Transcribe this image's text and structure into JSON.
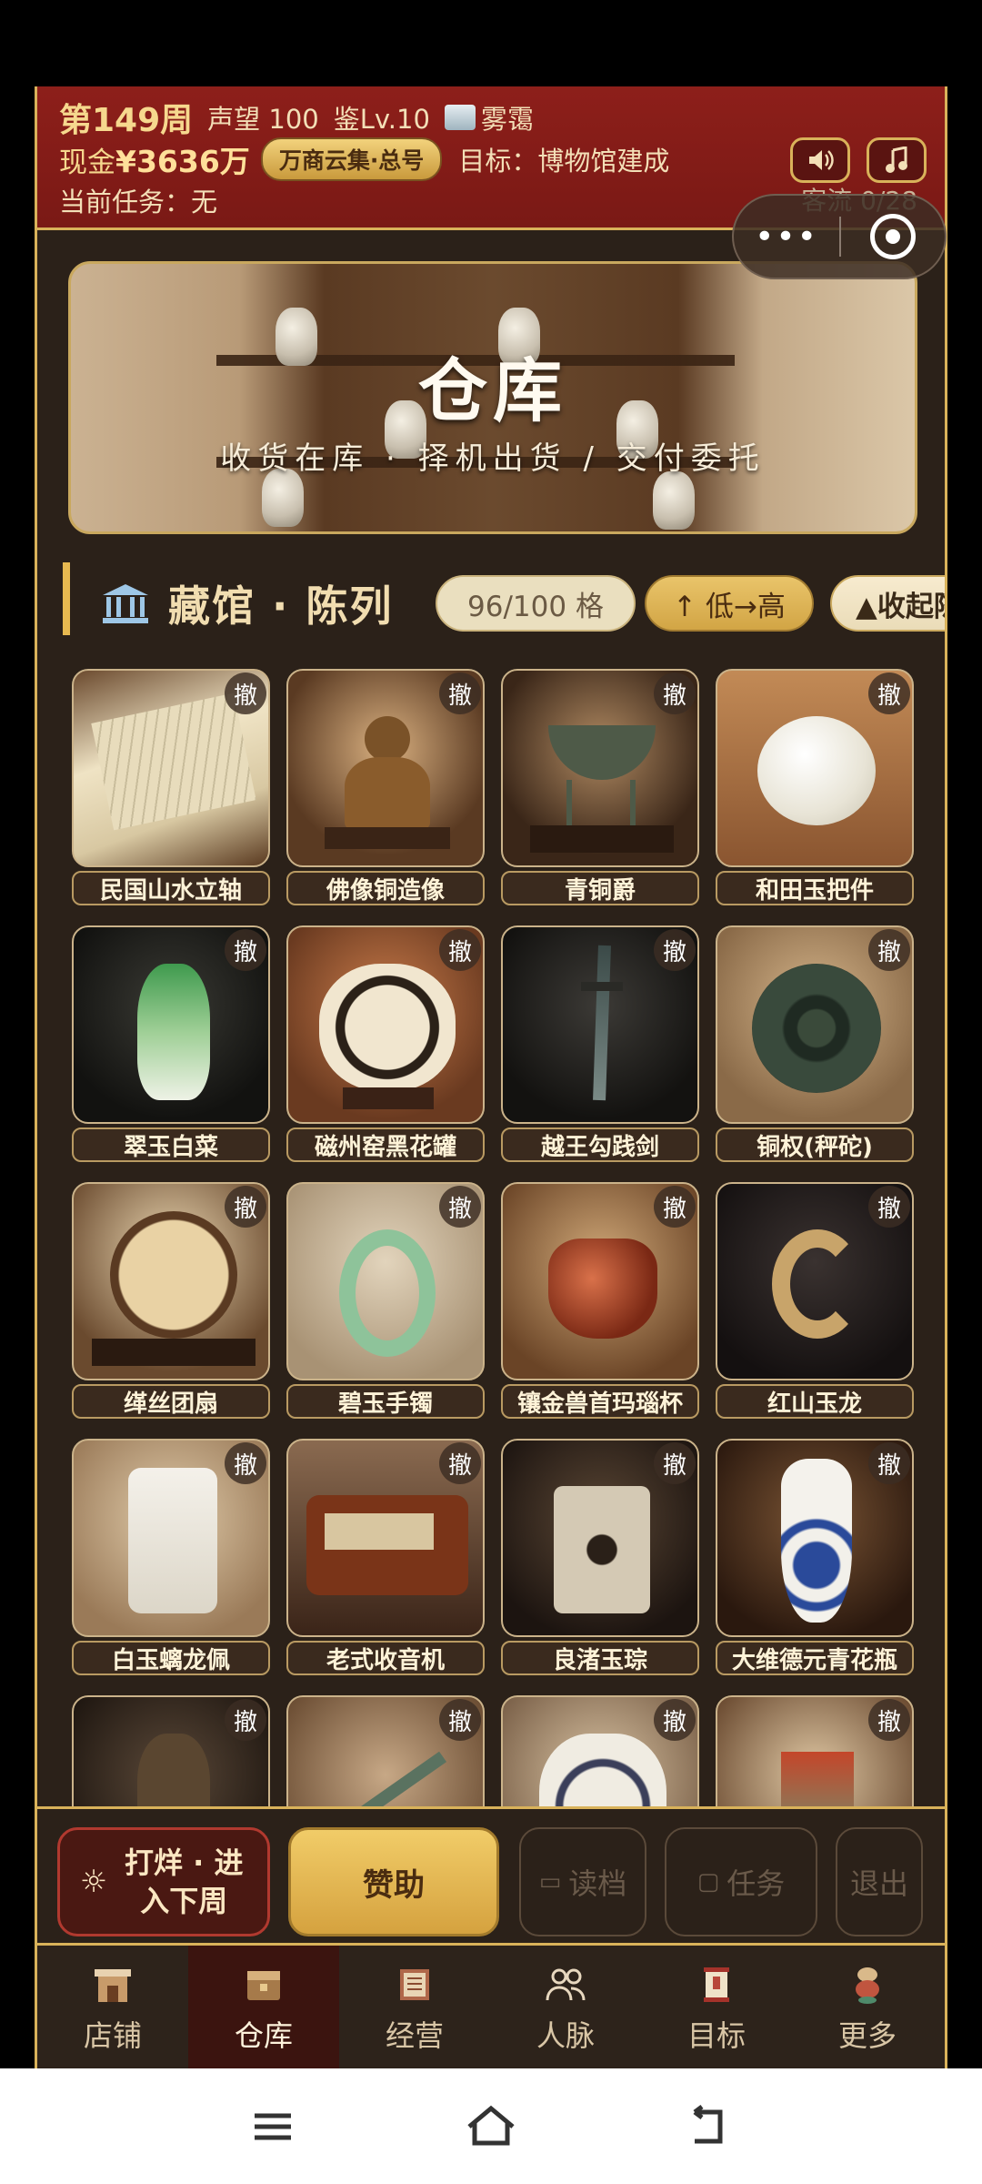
{
  "hud": {
    "week": "第149周",
    "reputation": "声望 100",
    "appraisal": "鉴Lv.10",
    "weather": "雾霭",
    "cash_prefix": "现金",
    "cash_value": "¥3636万",
    "guild_badge": "万商云集·总号",
    "goal": "目标：博物馆建成",
    "task": "当前任务：无",
    "traffic": "客流 0/28",
    "sound_icon": "speaker-icon",
    "music_icon": "music-note-icon"
  },
  "capsule": {
    "more": "•••"
  },
  "banner": {
    "title": "仓库",
    "subtitle": "收货在库 · 择机出货 / 交付委托"
  },
  "section": {
    "title": "藏馆 · 陈列",
    "slots": "96/100 格",
    "sort": "↑ 低→高",
    "collapse": "▲收起陈"
  },
  "items": [
    {
      "name": "民国山水立轴",
      "badge": "撤"
    },
    {
      "name": "佛像铜造像",
      "badge": "撤"
    },
    {
      "name": "青铜爵",
      "badge": "撤"
    },
    {
      "name": "和田玉把件",
      "badge": "撤"
    },
    {
      "name": "翠玉白菜",
      "badge": "撤"
    },
    {
      "name": "磁州窑黑花罐",
      "badge": "撤"
    },
    {
      "name": "越王勾践剑",
      "badge": "撤"
    },
    {
      "name": "铜权(秤砣)",
      "badge": "撤"
    },
    {
      "name": "缂丝团扇",
      "badge": "撤"
    },
    {
      "name": "碧玉手镯",
      "badge": "撤"
    },
    {
      "name": "镶金兽首玛瑙杯",
      "badge": "撤"
    },
    {
      "name": "红山玉龙",
      "badge": "撤"
    },
    {
      "name": "白玉螭龙佩",
      "badge": "撤"
    },
    {
      "name": "老式收音机",
      "badge": "撤"
    },
    {
      "name": "良渚玉琮",
      "badge": "撤"
    },
    {
      "name": "大维德元青花瓶",
      "badge": "撤"
    },
    {
      "name": "",
      "badge": "撤"
    },
    {
      "name": "",
      "badge": "撤"
    },
    {
      "name": "",
      "badge": "撤"
    },
    {
      "name": "",
      "badge": "撤"
    }
  ],
  "actions": {
    "next_week": "打烊 · 进入下周",
    "sponsor": "赞助",
    "load": "读档",
    "task": "任务",
    "exit": "退出"
  },
  "tabs": [
    {
      "label": "店铺",
      "icon": "shop-icon"
    },
    {
      "label": "仓库",
      "icon": "warehouse-icon"
    },
    {
      "label": "经营",
      "icon": "ledger-icon"
    },
    {
      "label": "人脉",
      "icon": "people-icon"
    },
    {
      "label": "目标",
      "icon": "scroll-icon"
    },
    {
      "label": "更多",
      "icon": "more-icon"
    }
  ],
  "active_tab": "仓库",
  "colors": {
    "accent": "#d9b25a",
    "header": "#8d1f1a",
    "background": "#2b2119"
  }
}
